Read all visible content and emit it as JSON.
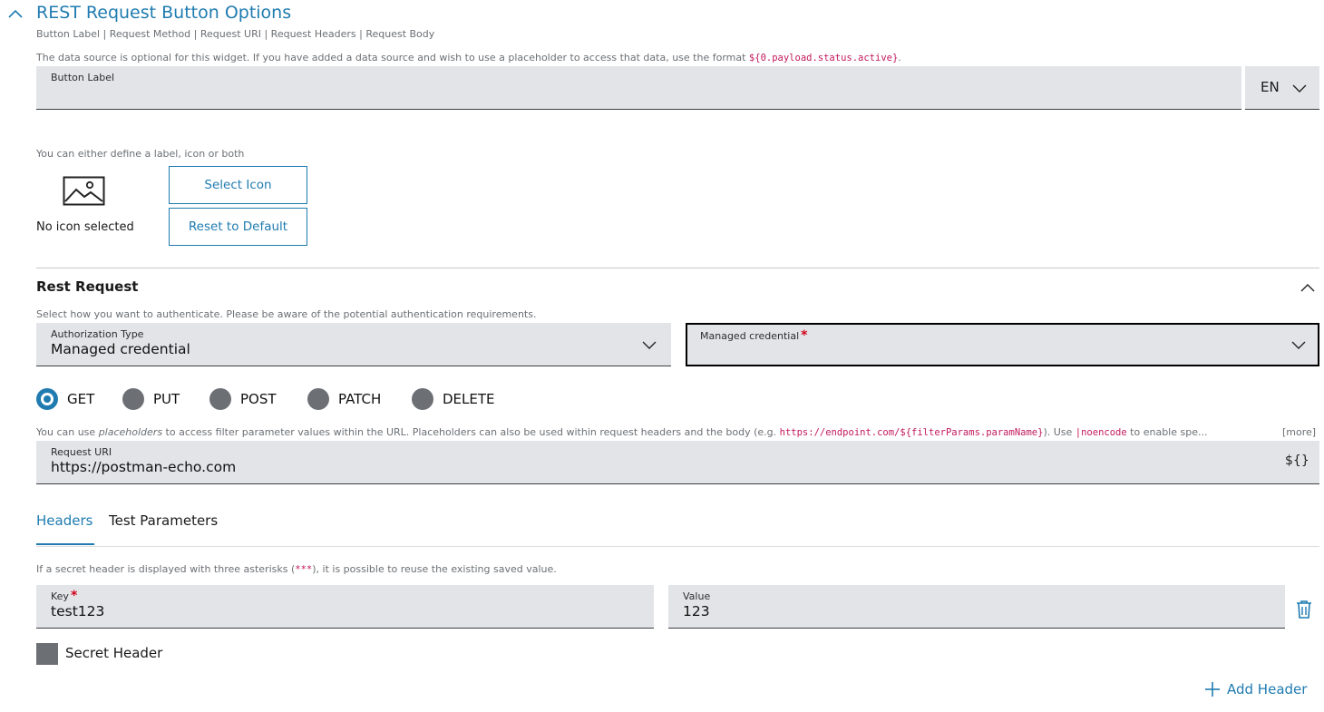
{
  "section": {
    "title": "REST Request Button Options",
    "subtitle": "Button Label | Request Method | Request URI | Request Headers | Request Body",
    "datasource_note_prefix": "The data source is optional for this widget. If you have added a data source and wish to use a placeholder to access that data, use the format ",
    "datasource_note_code": "${0.payload.status.active}",
    "datasource_note_suffix": "."
  },
  "button_label": {
    "label": "Button Label",
    "value": "",
    "language": "EN"
  },
  "icon": {
    "hint": "You can either define a label, icon or both",
    "status": "No icon selected",
    "select_label": "Select Icon",
    "reset_label": "Reset to Default"
  },
  "rest": {
    "title": "Rest Request",
    "auth_hint": "Select how you want to authenticate. Please be aware of the potential authentication requirements.",
    "auth_type_label": "Authorization Type",
    "auth_type_value": "Managed credential",
    "credential_label": "Managed credential",
    "credential_required": "*",
    "methods": [
      "GET",
      "PUT",
      "POST",
      "PATCH",
      "DELETE"
    ],
    "selected_method": "GET",
    "uri_hint_1": "You can use ",
    "uri_hint_em": "placeholders",
    "uri_hint_2": " to access filter parameter values within the URL. Placeholders can also be used within request headers and the body (e.g. ",
    "uri_hint_code1": "https://endpoint.com/${filterParams.paramName}",
    "uri_hint_3": "). Use ",
    "uri_hint_code2": "|noencode",
    "uri_hint_4": " to enable spe...",
    "uri_hint_more": "[more]",
    "uri_label": "Request URI",
    "uri_value": "https://postman-echo.com",
    "placeholder_button": "${}"
  },
  "tabs": {
    "headers": "Headers",
    "test_parameters": "Test Parameters"
  },
  "headers": {
    "hint_prefix": "If a secret header is displayed with three asterisks (",
    "hint_code": "***",
    "hint_suffix": "), it is possible to reuse the existing saved value.",
    "key_label": "Key",
    "key_required": "*",
    "key_value": "test123",
    "value_label": "Value",
    "value_value": "123",
    "secret_label": "Secret Header",
    "add_label": "Add Header"
  },
  "colors": {
    "accent": "#1f7bb0",
    "field_bg": "#e3e4e8",
    "required": "#d0021b",
    "code": "#c2185b"
  }
}
